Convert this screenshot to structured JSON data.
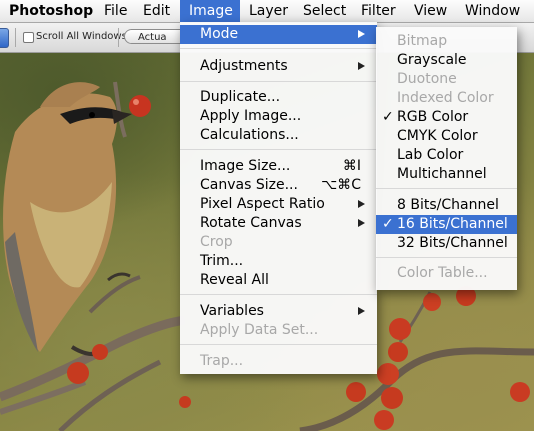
{
  "menubar": {
    "app": "Photoshop",
    "items": [
      "File",
      "Edit",
      "Image",
      "Layer",
      "Select",
      "Filter",
      "View",
      "Window"
    ],
    "active": "Image"
  },
  "options_bar": {
    "scroll_all_windows_label": "Scroll All Windows",
    "actual_pixels_label": "Actua"
  },
  "image_menu": {
    "items": [
      {
        "label": "Mode",
        "submenu": true,
        "highlighted": true
      },
      {
        "label": "Adjustments",
        "submenu": true
      },
      {
        "label": "Duplicate..."
      },
      {
        "label": "Apply Image..."
      },
      {
        "label": "Calculations..."
      },
      {
        "label": "Image Size...",
        "shortcut": "⌘I"
      },
      {
        "label": "Canvas Size...",
        "shortcut": "⌥⌘C"
      },
      {
        "label": "Pixel Aspect Ratio",
        "submenu": true
      },
      {
        "label": "Rotate Canvas",
        "submenu": true
      },
      {
        "label": "Crop",
        "disabled": true
      },
      {
        "label": "Trim..."
      },
      {
        "label": "Reveal All"
      },
      {
        "label": "Variables",
        "submenu": true
      },
      {
        "label": "Apply Data Set...",
        "disabled": true
      },
      {
        "label": "Trap...",
        "disabled": true
      }
    ]
  },
  "mode_menu": {
    "items": [
      {
        "label": "Bitmap",
        "disabled": true
      },
      {
        "label": "Grayscale"
      },
      {
        "label": "Duotone",
        "disabled": true
      },
      {
        "label": "Indexed Color",
        "disabled": true
      },
      {
        "label": "RGB Color",
        "checked": true
      },
      {
        "label": "CMYK Color"
      },
      {
        "label": "Lab Color"
      },
      {
        "label": "Multichannel"
      },
      {
        "label": "8 Bits/Channel"
      },
      {
        "label": "16 Bits/Channel",
        "checked": true,
        "highlighted": true
      },
      {
        "label": "32 Bits/Channel"
      },
      {
        "label": "Color Table...",
        "disabled": true
      }
    ],
    "check_glyph": "✓"
  },
  "colors": {
    "highlight": "#3b71d1",
    "disabled_text": "#a8a8a8"
  }
}
